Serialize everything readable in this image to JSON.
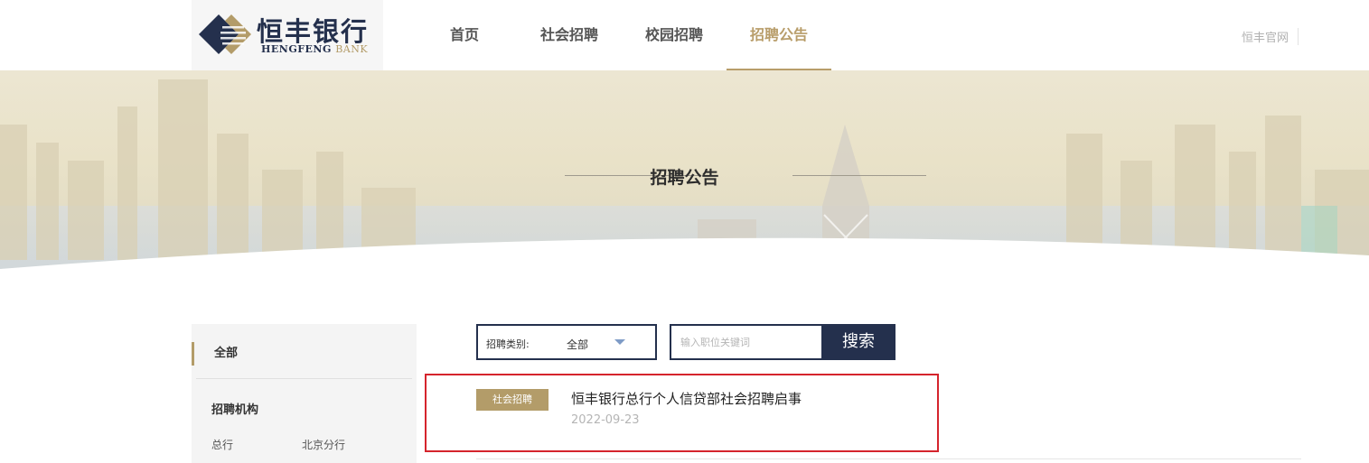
{
  "logo": {
    "cn": "恒丰银行",
    "en_left": "HENGFENG",
    "en_right": "BANK"
  },
  "nav": [
    "首页",
    "社会招聘",
    "校园招聘",
    "招聘公告"
  ],
  "official_link": "恒丰官网",
  "banner": {
    "title": "招聘公告"
  },
  "sidebar": {
    "all_label": "全部",
    "section_heading": "招聘机构",
    "orgs": [
      "总行",
      "北京分行"
    ]
  },
  "filter": {
    "label": "招聘类别:",
    "value": "全部"
  },
  "search": {
    "placeholder": "输入职位关键词",
    "button": "搜索"
  },
  "results": [
    {
      "tag": "社会招聘",
      "title": "恒丰银行总行个人信贷部社会招聘启事",
      "date": "2022-09-23"
    }
  ],
  "colors": {
    "navy": "#24304d",
    "gold": "#b39c69",
    "highlight": "#d5242c"
  }
}
